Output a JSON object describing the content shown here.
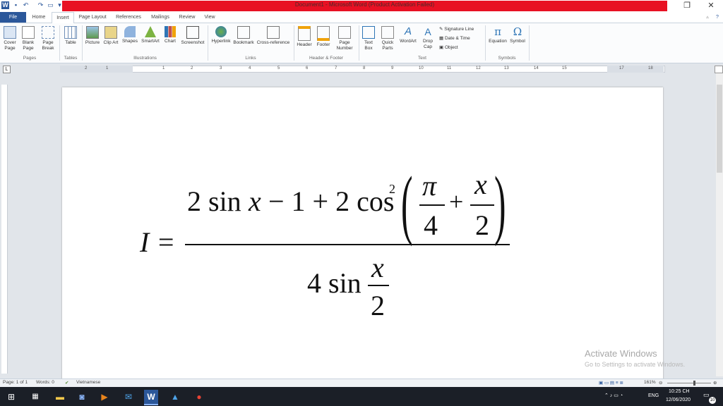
{
  "window": {
    "title": "Document1 - Microsoft Word (Product Activation Failed)"
  },
  "tabs": [
    {
      "label": "File"
    },
    {
      "label": "Home"
    },
    {
      "label": "Insert"
    },
    {
      "label": "Page Layout"
    },
    {
      "label": "References"
    },
    {
      "label": "Mailings"
    },
    {
      "label": "Review"
    },
    {
      "label": "View"
    }
  ],
  "ribbon": {
    "buttons": [
      "Cover Page",
      "Blank Page",
      "Page Break",
      "Table",
      "Picture",
      "Clip Art",
      "Shapes",
      "SmartArt",
      "Chart",
      "Screenshot",
      "Hyperlink",
      "Bookmark",
      "Cross-reference",
      "Header",
      "Footer",
      "Page Number",
      "Text Box",
      "Quick Parts",
      "WordArt",
      "Drop Cap",
      "Equation",
      "Symbol"
    ],
    "small": [
      "Signature Line",
      "Date & Time",
      "Object"
    ],
    "groups": [
      "Pages",
      "Tables",
      "Illustrations",
      "Links",
      "Header & Footer",
      "Text",
      "Symbols"
    ]
  },
  "ruler": {
    "numbers": [
      "2",
      "1",
      "1",
      "2",
      "3",
      "4",
      "5",
      "6",
      "7",
      "8",
      "9",
      "10",
      "11",
      "12",
      "13",
      "14",
      "15",
      "17",
      "18"
    ]
  },
  "formula": {
    "lhs": "I =",
    "num_part1": "2 sin",
    "num_x": "x",
    "num_part2": "− 1 + 2 cos",
    "exp": "2",
    "pi": "π",
    "four": "4",
    "plus": "+",
    "x_top": "x",
    "two": "2",
    "den_part": "4 sin",
    "den_x": "x",
    "den_two": "2"
  },
  "watermark": {
    "line1": "Activate Windows",
    "line2": "Go to Settings to activate Windows."
  },
  "status": {
    "page": "Page: 1 of 1",
    "words": "Words: 0",
    "language": "Vietnamese",
    "zoom": "161%"
  },
  "tray": {
    "lang": "ENG",
    "time": "10:25 CH",
    "date": "12/06/2020",
    "notif": "10"
  }
}
